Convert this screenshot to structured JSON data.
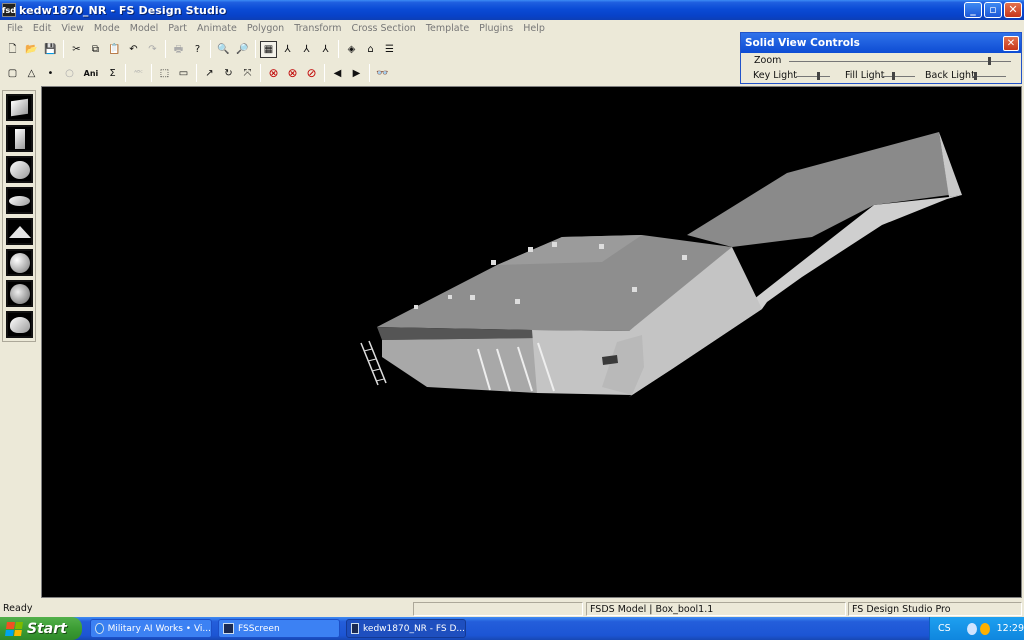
{
  "window": {
    "title": "kedw1870_NR - FS Design Studio",
    "app_icon_label": "fsd",
    "minimize_glyph": "_",
    "maximize_glyph": "▫",
    "close_glyph": "✕"
  },
  "menu": [
    "File",
    "Edit",
    "View",
    "Mode",
    "Model",
    "Part",
    "Animate",
    "Polygon",
    "Transform",
    "Cross Section",
    "Template",
    "Plugins",
    "Help"
  ],
  "toolbar1": [
    {
      "icon": "new-file-icon",
      "glyph": "🗋"
    },
    {
      "icon": "open-folder-icon",
      "glyph": "📂"
    },
    {
      "icon": "save-icon",
      "glyph": "💾"
    },
    {
      "icon": "cut-icon",
      "glyph": "✂"
    },
    {
      "icon": "copy-icon",
      "glyph": "⧉"
    },
    {
      "icon": "paste-icon",
      "glyph": "📋"
    },
    {
      "icon": "undo-icon",
      "glyph": "↶"
    },
    {
      "icon": "redo-icon",
      "glyph": "↷"
    },
    {
      "icon": "print-icon",
      "glyph": "🖶"
    },
    {
      "icon": "help-icon",
      "glyph": "?"
    },
    {
      "icon": "zoom-in-icon",
      "glyph": "🔍"
    },
    {
      "icon": "zoom-out-icon",
      "glyph": "🔎"
    },
    {
      "icon": "grid-icon",
      "glyph": "▦"
    },
    {
      "icon": "axis-x-icon",
      "glyph": "⅄"
    },
    {
      "icon": "axis-y-icon",
      "glyph": "⅄"
    },
    {
      "icon": "axis-z-icon",
      "glyph": "⅄"
    },
    {
      "icon": "view-3d-icon",
      "glyph": "◈"
    },
    {
      "icon": "home-icon",
      "glyph": "⌂"
    },
    {
      "icon": "properties-icon",
      "glyph": "☰"
    }
  ],
  "toolbar2": [
    {
      "icon": "select-icon",
      "glyph": "▢"
    },
    {
      "icon": "triangle-icon",
      "glyph": "△"
    },
    {
      "icon": "point-icon",
      "glyph": "•"
    },
    {
      "icon": "circle-icon",
      "glyph": "○"
    },
    {
      "icon": "animation-icon",
      "glyph": "Ani"
    },
    {
      "icon": "sum-icon",
      "glyph": "Σ"
    },
    {
      "icon": "text-icon",
      "glyph": "ᴬᴮᶜ"
    },
    {
      "icon": "marquee-icon",
      "glyph": "⬚"
    },
    {
      "icon": "ruler-icon",
      "glyph": "▭"
    },
    {
      "icon": "arrow-icon",
      "glyph": "↗"
    },
    {
      "icon": "rotate-icon",
      "glyph": "↻"
    },
    {
      "icon": "scale-icon",
      "glyph": "⤧"
    },
    {
      "icon": "delete-icon",
      "glyph": "⊗"
    },
    {
      "icon": "delete-part-icon",
      "glyph": "⊗"
    },
    {
      "icon": "delete-all-icon",
      "glyph": "⊘"
    },
    {
      "icon": "previous-icon",
      "glyph": "◀"
    },
    {
      "icon": "next-icon",
      "glyph": "▶"
    },
    {
      "icon": "binoculars-icon",
      "glyph": "👓"
    }
  ],
  "solid_view_controls": {
    "title": "Solid View Controls",
    "close_glyph": "✕",
    "zoom_label": "Zoom",
    "key_light_label": "Key Light",
    "fill_light_label": "Fill Light",
    "back_light_label": "Back Light",
    "zoom_level": 0.9,
    "key_light_level": 0.65,
    "fill_light_level": 0.35,
    "back_light_level": 0.1
  },
  "palette": [
    "box-shape-icon",
    "cylinder-shape-icon",
    "sphere-shape-icon",
    "ellipse-shape-icon",
    "pyramid-shape-icon",
    "globe-shape-icon",
    "globe-shape-2-icon",
    "cone-shape-icon"
  ],
  "status": {
    "left": "Ready",
    "middle": "FSDS Model | Box_bool1.1",
    "right": "FS Design Studio Pro"
  },
  "taskbar": {
    "start_label": "Start",
    "tasks": [
      {
        "label": "Military AI Works • Vi...",
        "active": false
      },
      {
        "label": "FSScreen",
        "active": false
      },
      {
        "label": "kedw1870_NR - FS D...",
        "active": true
      }
    ],
    "language": "CS",
    "clock": "12:29"
  },
  "colors": {
    "viewport_bg": "#000000",
    "model_top": "#8e8e8e",
    "model_side": "#c8c8c8",
    "model_front": "#a9a9a9"
  }
}
